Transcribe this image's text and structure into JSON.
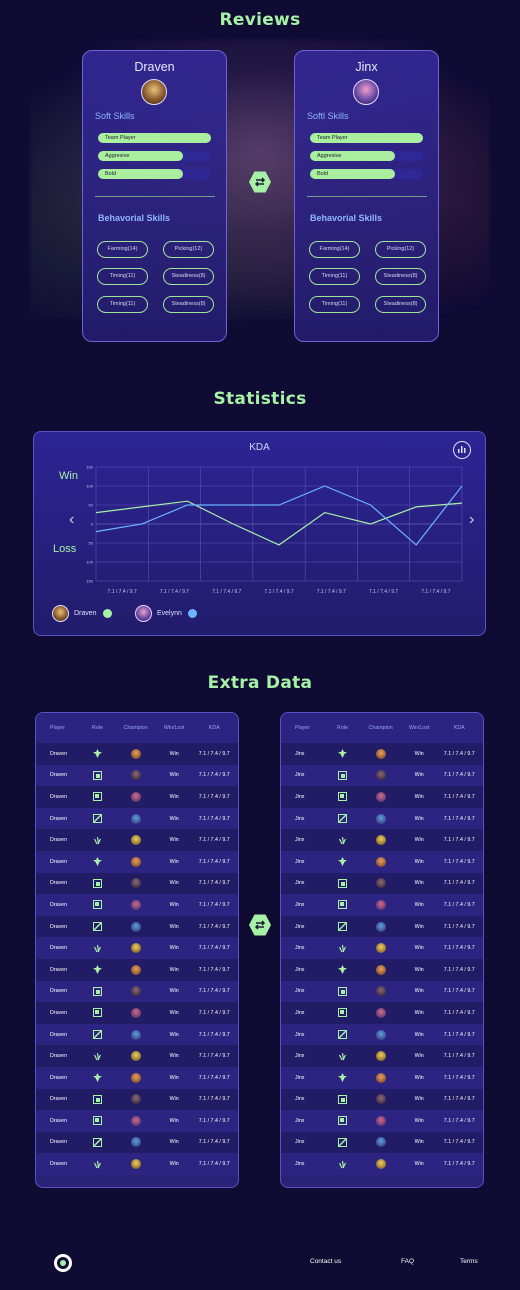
{
  "reviews": {
    "title": "Reviews",
    "cards": [
      {
        "name": "Draven",
        "soft_title": "Soft Skills",
        "soft_skills": [
          {
            "label": "Team Player",
            "level": 1.0
          },
          {
            "label": "Aggresive",
            "level": 0.75
          },
          {
            "label": "Bold",
            "level": 0.75
          }
        ],
        "behavior_title": "Behavorial Skills",
        "pills": [
          "Farming(14)",
          "Picking(12)",
          "Timing(11)",
          "Steadiness(8)",
          "Timing(11)",
          "Steadiness(8)"
        ]
      },
      {
        "name": "Jinx",
        "soft_title": "Softl Skills",
        "soft_skills": [
          {
            "label": "Team Player",
            "level": 1.0
          },
          {
            "label": "Aggresive",
            "level": 0.75
          },
          {
            "label": "Bold",
            "level": 0.75
          }
        ],
        "behavior_title": "Behavorial Skills",
        "pills": [
          "Farming(14)",
          "Picking(12)",
          "Timing(11)",
          "Steadiness(8)",
          "Timing(11)",
          "Steadiness(8)"
        ]
      }
    ]
  },
  "statistics": {
    "title": "Statistics",
    "win_label": "Win",
    "loss_label": "Loss",
    "legend": [
      {
        "name": "Draven",
        "color": "#a6f1a6"
      },
      {
        "name": "Evelynn",
        "color": "#6ab4ff"
      }
    ]
  },
  "chart_data": {
    "type": "line",
    "title": "KDA",
    "categories": [
      "7.1 / 7.4 / 9.7",
      "7.1 / 7.4 / 9.7",
      "7.1 / 7.4 / 9.7",
      "7.1 / 7.4 / 9.7",
      "7.1 / 7.4 / 9.7",
      "7.1 / 7.4 / 9.7",
      "7.1 / 7.4 / 9.7"
    ],
    "yticks": [
      150,
      100,
      50,
      0,
      50,
      100,
      150
    ],
    "ylim": [
      -150,
      150
    ],
    "grid": true,
    "series": [
      {
        "name": "Draven",
        "color": "#a6f1a6",
        "values": [
          30,
          45,
          60,
          0,
          -55,
          30,
          0,
          45,
          55
        ]
      },
      {
        "name": "Evelynn",
        "color": "#6ab4ff",
        "values": [
          -20,
          0,
          50,
          50,
          50,
          100,
          50,
          -55,
          100
        ]
      }
    ]
  },
  "extra": {
    "title": "Extra Data",
    "headers": [
      "Player",
      "Role",
      "Champion",
      "Win/Lost",
      "KDA"
    ],
    "left_player": "Draven",
    "right_player": "Jinx",
    "result": "Win",
    "kda": "7.1 / 7.4 / 9.7",
    "left_rows": 20,
    "right_rows": 20
  },
  "footer": {
    "contact": "Contact us",
    "faq": "FAQ",
    "terms": "Terms"
  }
}
